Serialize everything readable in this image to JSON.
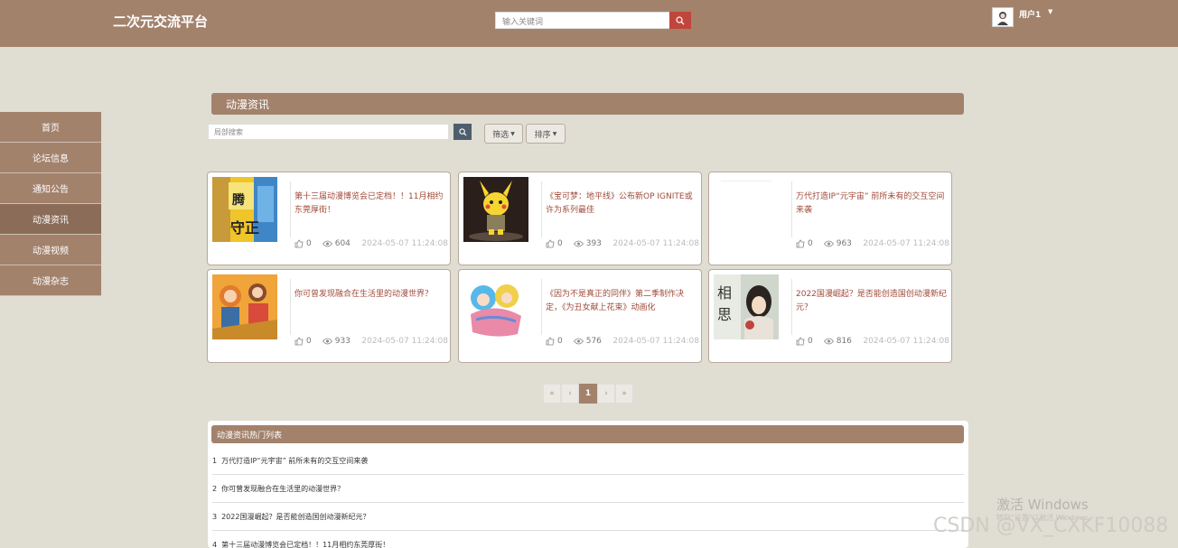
{
  "header": {
    "logo": "二次元交流平台",
    "search_placeholder": "输入关键词",
    "user_name": "用户1"
  },
  "sidebar": {
    "items": [
      {
        "label": "首页"
      },
      {
        "label": "论坛信息"
      },
      {
        "label": "通知公告"
      },
      {
        "label": "动漫资讯",
        "active": true
      },
      {
        "label": "动漫视频"
      },
      {
        "label": "动漫杂志"
      }
    ]
  },
  "main": {
    "section_title": "动漫资讯",
    "local_search_placeholder": "局部搜索",
    "filter_label": "筛选",
    "sort_label": "排序"
  },
  "cards": [
    {
      "title": "第十三届动漫博览会已定档！！11月相约东莞厚街！",
      "likes": "0",
      "views": "604",
      "date": "2024-05-07 11:24:08"
    },
    {
      "title": "《宝可梦：地平线》公布新OP IGNITE或许为系列最佳",
      "likes": "0",
      "views": "393",
      "date": "2024-05-07 11:24:08"
    },
    {
      "title": "万代打造IP“元宇宙” 前所未有的交互空间来袭",
      "likes": "0",
      "views": "963",
      "date": "2024-05-07 11:24:08"
    },
    {
      "title": "你可曾发现融合在生活里的动漫世界？",
      "likes": "0",
      "views": "933",
      "date": "2024-05-07 11:24:08"
    },
    {
      "title": "《因为不是真正的同伴》第二季制作决定，《为丑女献上花束》动画化",
      "likes": "0",
      "views": "576",
      "date": "2024-05-07 11:24:08"
    },
    {
      "title": "2022国漫崛起？是否能创造国创动漫新纪元？",
      "likes": "0",
      "views": "816",
      "date": "2024-05-07 11:24:08"
    }
  ],
  "pagination": {
    "first": "«",
    "prev": "‹",
    "current": "1",
    "next": "›",
    "last": "»"
  },
  "hot_list": {
    "title": "动漫资讯热门列表",
    "items": [
      {
        "num": "1",
        "text": "万代打造IP“元宇宙” 前所未有的交互空间来袭"
      },
      {
        "num": "2",
        "text": "你可曾发现融合在生活里的动漫世界？"
      },
      {
        "num": "3",
        "text": "2022国漫崛起？是否能创造国创动漫新纪元？"
      },
      {
        "num": "4",
        "text": "第十三届动漫博览会已定档！！11月相约东莞厚街！"
      }
    ]
  },
  "watermarks": {
    "windows_line1": "激活 Windows",
    "windows_line2": "转到\"设置\"以激活 Windows。",
    "csdn": "CSDN @VX_CXKF10088"
  },
  "colors": {
    "header_bg": "#a3826c",
    "page_bg": "#e0ddd3",
    "title_text": "#a04a3a",
    "search_button": "#c0453b"
  }
}
